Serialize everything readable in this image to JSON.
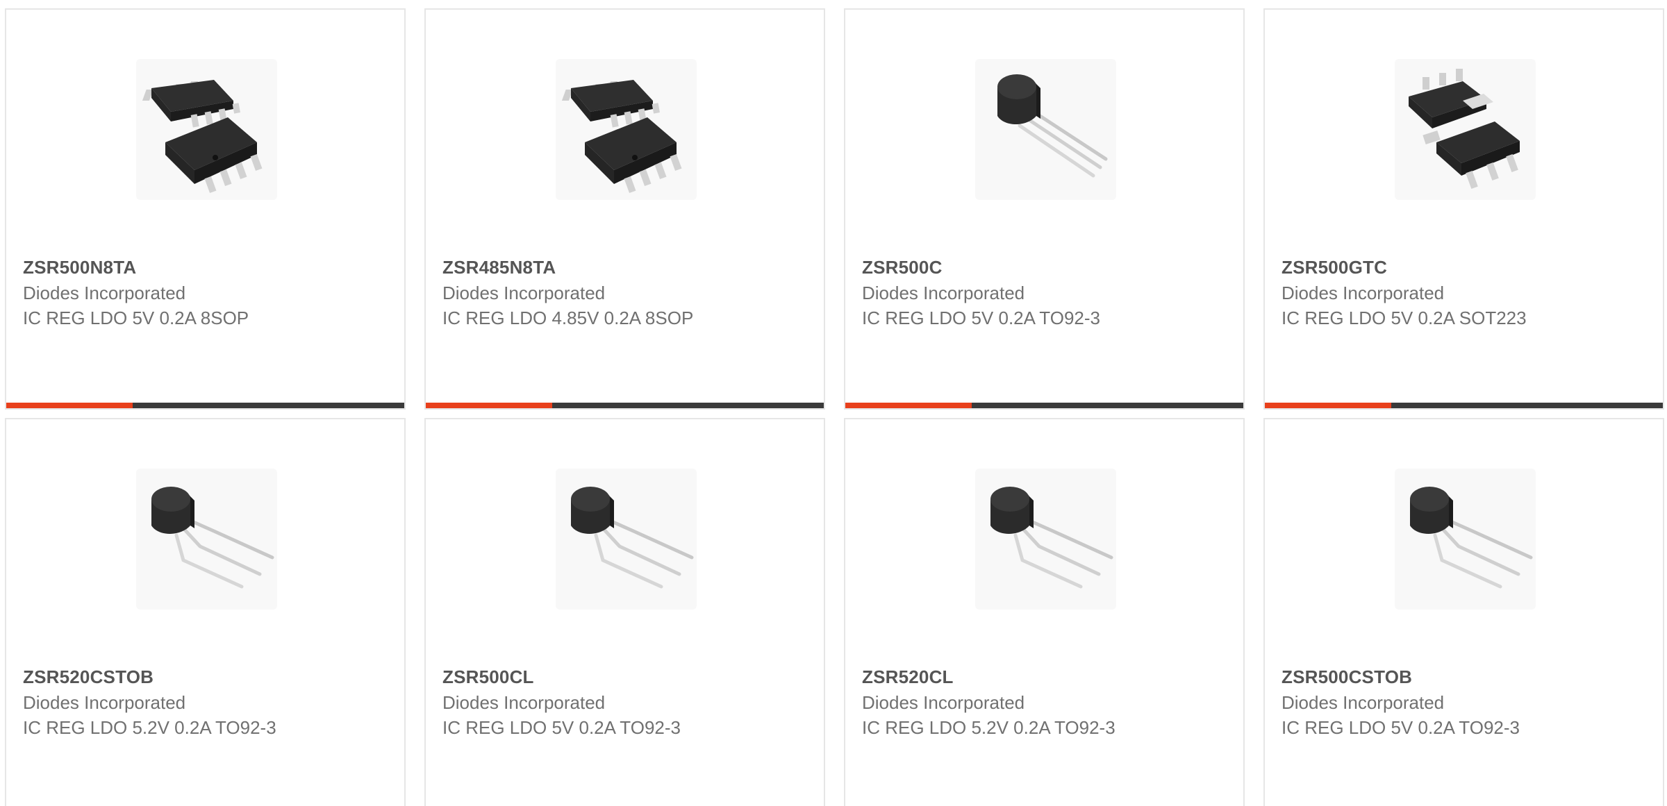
{
  "products": [
    {
      "part": "ZSR500N8TA",
      "manufacturer": "Diodes Incorporated",
      "description": "IC REG LDO 5V 0.2A 8SOP",
      "package_icon": "soic-8-package-icon"
    },
    {
      "part": "ZSR485N8TA",
      "manufacturer": "Diodes Incorporated",
      "description": "IC REG LDO 4.85V 0.2A 8SOP",
      "package_icon": "soic-8-package-icon"
    },
    {
      "part": "ZSR500C",
      "manufacturer": "Diodes Incorporated",
      "description": "IC REG LDO 5V 0.2A TO92-3",
      "package_icon": "to92-package-icon"
    },
    {
      "part": "ZSR500GTC",
      "manufacturer": "Diodes Incorporated",
      "description": "IC REG LDO 5V 0.2A SOT223",
      "package_icon": "sot223-package-icon"
    },
    {
      "part": "ZSR520CSTOB",
      "manufacturer": "Diodes Incorporated",
      "description": "IC REG LDO 5.2V 0.2A TO92-3",
      "package_icon": "to92-bent-package-icon"
    },
    {
      "part": "ZSR500CL",
      "manufacturer": "Diodes Incorporated",
      "description": "IC REG LDO 5V 0.2A TO92-3",
      "package_icon": "to92-bent-package-icon"
    },
    {
      "part": "ZSR520CL",
      "manufacturer": "Diodes Incorporated",
      "description": "IC REG LDO 5.2V 0.2A TO92-3",
      "package_icon": "to92-bent-package-icon"
    },
    {
      "part": "ZSR500CSTOB",
      "manufacturer": "Diodes Incorporated",
      "description": "IC REG LDO 5V 0.2A TO92-3",
      "package_icon": "to92-bent-package-icon"
    }
  ],
  "colors": {
    "accent": "#e8401c",
    "bar": "#3a3a3a",
    "border": "#e6e6e6",
    "part_text": "#555555",
    "body_text": "#707070"
  }
}
